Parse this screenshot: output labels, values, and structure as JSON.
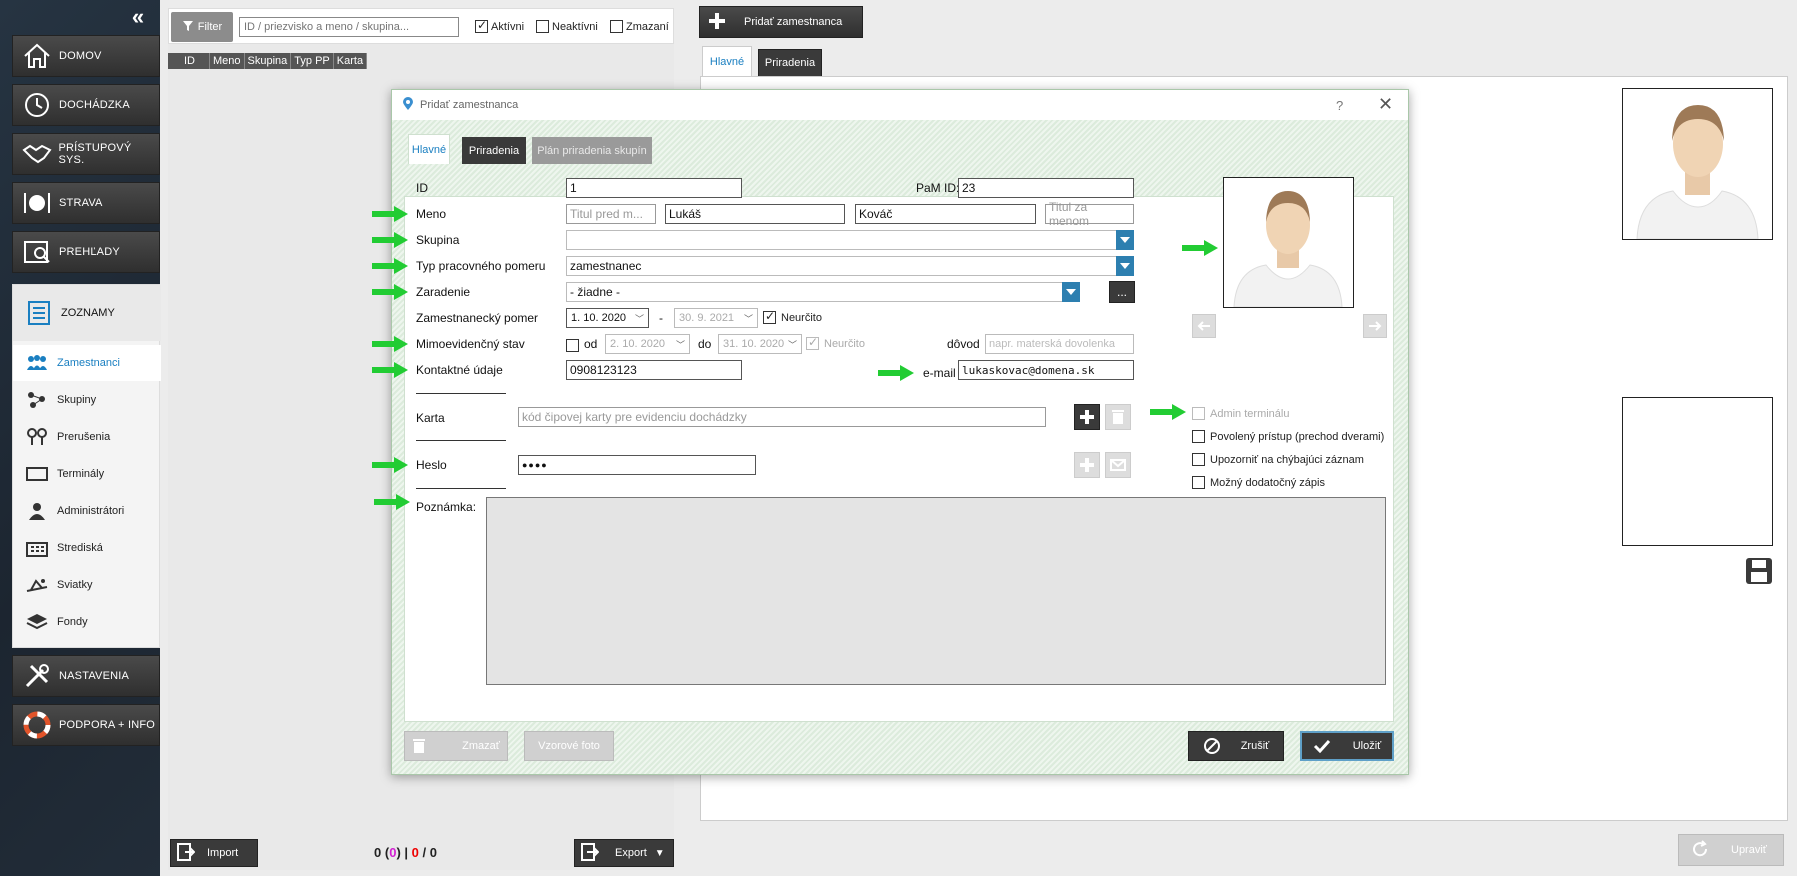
{
  "sidebar": {
    "main_items": [
      {
        "label": "DOMOV",
        "icon": "home-icon"
      },
      {
        "label": "DOCHÁDZKA",
        "icon": "clock-icon"
      },
      {
        "label": "PRÍSTUPOVÝ SYS.",
        "icon": "handshake-icon"
      },
      {
        "label": "STRAVA",
        "icon": "plate-icon"
      },
      {
        "label": "PREHĽADY",
        "icon": "report-icon"
      }
    ],
    "section": {
      "label": "ZOZNAMY",
      "icon": "list-icon"
    },
    "sub_items": [
      {
        "label": "Zamestnanci",
        "icon": "people-icon",
        "active": true
      },
      {
        "label": "Skupiny",
        "icon": "group-icon"
      },
      {
        "label": "Prerušenia",
        "icon": "pin-icon"
      },
      {
        "label": "Terminály",
        "icon": "terminal-icon"
      },
      {
        "label": "Administrátori",
        "icon": "admin-icon"
      },
      {
        "label": "Strediská",
        "icon": "building-icon"
      },
      {
        "label": "Sviatky",
        "icon": "holiday-icon"
      },
      {
        "label": "Fondy",
        "icon": "layers-icon"
      }
    ],
    "bottom_items": [
      {
        "label": "NASTAVENIA",
        "icon": "tools-icon"
      },
      {
        "label": "PODPORA + INFO",
        "icon": "lifebuoy-icon"
      }
    ]
  },
  "list": {
    "filter_label": "Filter",
    "search_placeholder": "ID / priezvisko a meno / skupina...",
    "checkboxes": [
      {
        "label": "Aktívni",
        "checked": true
      },
      {
        "label": "Neaktívni",
        "checked": false
      },
      {
        "label": "Zmazaní",
        "checked": false
      }
    ],
    "columns": [
      "ID",
      "Meno",
      "Skupina",
      "Typ PP",
      "Karta"
    ],
    "import_label": "Import",
    "export_label": "Export",
    "counter": {
      "total": "0",
      "open": "(",
      "pink": "0",
      "close": ")",
      "sep1": "|",
      "red": "0",
      "sep2": "/",
      "last": "0"
    }
  },
  "main": {
    "add_employee_label": "Pridať zamestnanca",
    "tabs": [
      "Hlavné",
      "Priradenia"
    ],
    "edit_label": "Upraviť"
  },
  "dialog": {
    "title": "Pridať zamestnanca",
    "help": "?",
    "tabs": [
      "Hlavné",
      "Priradenia",
      "Plán priradenia skupín"
    ],
    "fields": {
      "id_label": "ID",
      "id_value": "1",
      "pam_label": "PaM ID:",
      "pam_value": "23",
      "meno_label": "Meno",
      "title_before_ph": "Titul pred m...",
      "first_name": "Lukáš",
      "last_name": "Kováč",
      "title_after_ph": "Titul za menom",
      "skupina_label": "Skupina",
      "skupina_value": "",
      "typ_label": "Typ pracovného pomeru",
      "typ_value": "zamestnanec",
      "zaradenie_label": "Zaradenie",
      "zaradenie_value": "- žiadne -",
      "more_btn": "...",
      "pomer_label": "Zamestnanecký pomer",
      "pomer_from": "1. 10. 2020",
      "pomer_dash": "-",
      "pomer_to": "30. 9. 2021",
      "neurcito_label": "Neurčito",
      "mimo_label": "Mimoevidenčný stav",
      "od_label": "od",
      "mimo_from": "2. 10. 2020",
      "do_label": "do",
      "mimo_to": "31. 10. 2020",
      "neurcito2_label": "Neurčito",
      "dovod_label": "dôvod",
      "dovod_ph": "napr. materská dovolenka",
      "kontakt_label": "Kontaktné údaje",
      "kontakt_value": "0908123123",
      "email_label": "e-mail",
      "email_value": "lukaskovac@domena.sk",
      "karta_label": "Karta",
      "karta_ph": "kód čipovej karty pre evidenciu dochádzky",
      "heslo_label": "Heslo",
      "heslo_value": "●●●●",
      "poznamka_label": "Poznámka:"
    },
    "options": [
      {
        "label": "Admin terminálu",
        "checked": false,
        "disabled": true
      },
      {
        "label": "Povolený prístup (prechod dverami)",
        "checked": false
      },
      {
        "label": "Upozorniť na chýbajúci záznam",
        "checked": false
      },
      {
        "label": "Možný dodatočný zápis",
        "checked": false
      }
    ],
    "footer": {
      "delete_label": "Zmazať",
      "sample_photo_label": "Vzorové foto",
      "cancel_label": "Zrušiť",
      "save_label": "Uložiť"
    }
  },
  "colors": {
    "accent": "#1a7fc1",
    "arrow": "#22cc33",
    "combo": "#2d7fb0",
    "dark_btn": "#3a3a3a"
  }
}
